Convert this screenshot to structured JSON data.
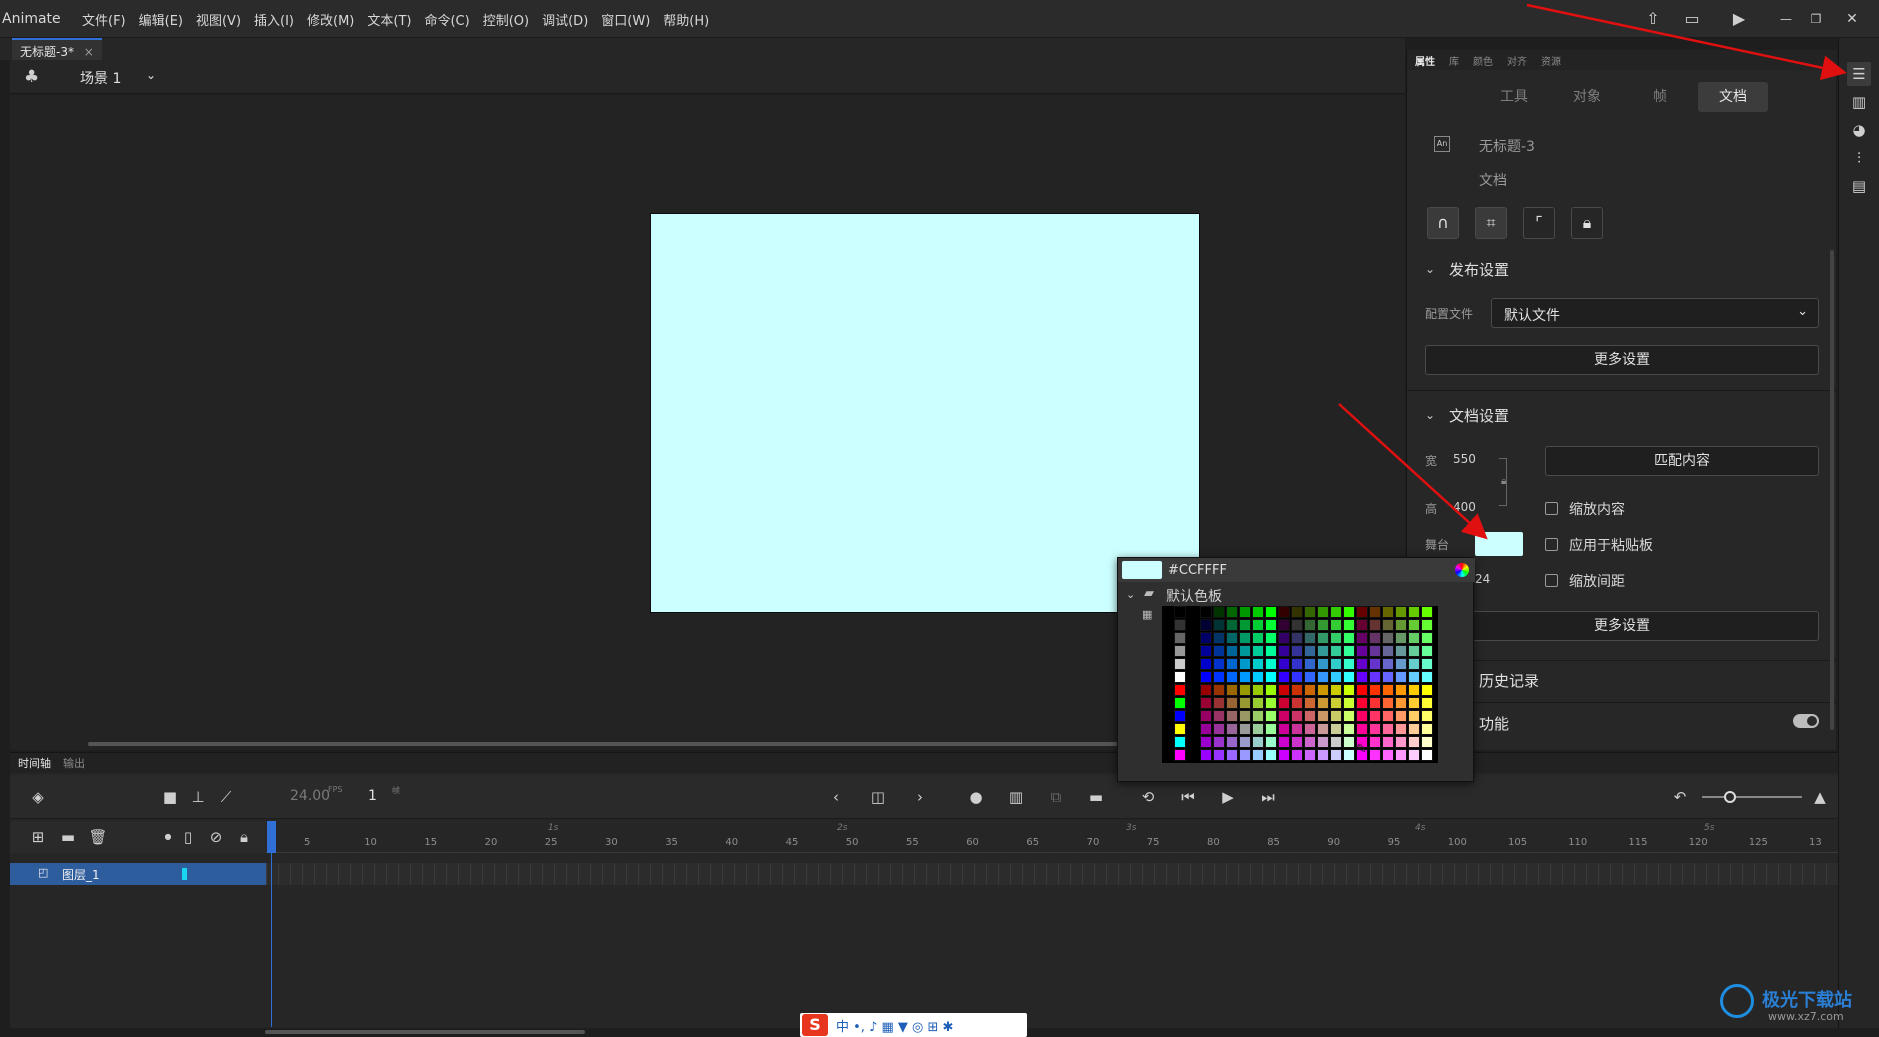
{
  "menubar": {
    "app_name": "Animate",
    "items": [
      "文件(F)",
      "编辑(E)",
      "视图(V)",
      "插入(I)",
      "修改(M)",
      "文本(T)",
      "命令(C)",
      "控制(O)",
      "调试(D)",
      "窗口(W)",
      "帮助(H)"
    ]
  },
  "doc_tab": {
    "title": "无标题-3*",
    "close": "×"
  },
  "scene": {
    "label": "场景 1"
  },
  "panel": {
    "tabs": [
      "属性",
      "库",
      "颜色",
      "对齐",
      "资源"
    ],
    "subtabs": [
      "工具",
      "对象",
      "帧",
      "文档"
    ],
    "doc_name": "无标题-3",
    "doc_type": "文档",
    "publish": {
      "title": "发布设置",
      "profile_label": "配置文件",
      "profile_value": "默认文件",
      "more_button": "更多设置"
    },
    "doc_settings": {
      "title": "文档设置",
      "width_label": "宽",
      "width_value": "550",
      "height_label": "高",
      "height_value": "400",
      "match_button": "匹配内容",
      "stage_label": "舞台",
      "stage_color": "#ccffff",
      "fps_value": "24",
      "scale_content": "缩放内容",
      "apply_paste": "应用于粘贴板",
      "scale_spacing": "缩放间距",
      "more_button": "更多设置"
    },
    "history": "历史记录",
    "features": "功能"
  },
  "color_picker": {
    "hex": "#CCFFFF",
    "palette_label": "默认色板"
  },
  "timeline": {
    "tabs": [
      "时间轴",
      "输出"
    ],
    "fps": "24.00",
    "fps_unit": "FPS",
    "frame": "1",
    "frame_unit": "帧",
    "layer_name": "图层_1",
    "ticks": [
      "5",
      "10",
      "15",
      "20",
      "25",
      "30",
      "35",
      "40",
      "45",
      "50",
      "55",
      "60",
      "65",
      "70",
      "75",
      "80",
      "85",
      "90",
      "95",
      "100",
      "105",
      "110",
      "115",
      "120",
      "125",
      "13"
    ],
    "seconds": [
      "1s",
      "2s",
      "3s",
      "4s",
      "5s"
    ]
  },
  "watermark": {
    "cn": "极光下载站",
    "url": "www.xz7.com"
  },
  "colors": {
    "stage": "#ccffff",
    "accent": "#2f6fd6",
    "arrow": "#e01010"
  }
}
